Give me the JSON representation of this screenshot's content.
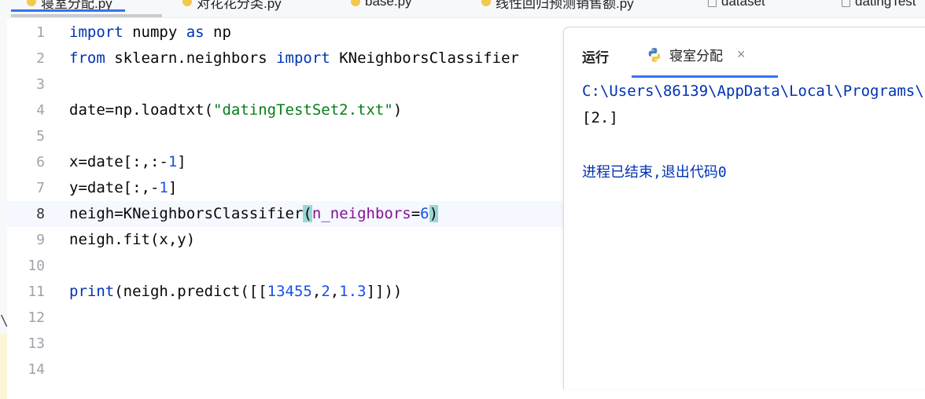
{
  "tabs": [
    {
      "label": "寝室分配.py",
      "icon": "python-file-icon"
    },
    {
      "label": "对花花分类.py",
      "icon": "python-file-icon"
    },
    {
      "label": "base.py",
      "icon": "python-file-icon"
    },
    {
      "label": "线性回归预测销售额.py",
      "icon": "python-file-icon"
    },
    {
      "label": "dataset",
      "icon": "text-file-icon"
    },
    {
      "label": "datingTest",
      "icon": "text-file-icon"
    }
  ],
  "line_numbers": [
    "1",
    "2",
    "3",
    "4",
    "5",
    "6",
    "7",
    "8",
    "9",
    "10",
    "11",
    "12",
    "13",
    "14"
  ],
  "code": {
    "l1": {
      "kw1": "import",
      "t1": " numpy ",
      "kw2": "as",
      "t2": " np"
    },
    "l2": {
      "kw1": "from",
      "t1": " sklearn.neighbors ",
      "kw2": "import",
      "t2": " KNeighborsClassifier"
    },
    "l4": {
      "t1": "date=np.loadtxt(",
      "s1": "\"datingTestSet2.txt\"",
      "t2": ")"
    },
    "l6": {
      "t1": "x=date[:,:-",
      "n1": "1",
      "t2": "]"
    },
    "l7": {
      "t1": "y=date[:,-",
      "n1": "1",
      "t2": "]"
    },
    "l8": {
      "t1": "neigh=KNeighborsClassifier",
      "p1": "(",
      "param": "n_neighbors",
      "t2": "=",
      "n1": "6",
      "p2": ")"
    },
    "l9": {
      "t1": "neigh.fit(x,y)"
    },
    "l11": {
      "kw1": "print",
      "t1": "(neigh.predict([[",
      "n1": "13455",
      "c1": ",",
      "n2": "2",
      "c2": ",",
      "n3": "1.3",
      "t2": "]]))"
    }
  },
  "run_panel": {
    "run_tab": "运行",
    "file_tab": "寝室分配",
    "close": "×",
    "output_path": "C:\\Users\\86139\\AppData\\Local\\Programs\\",
    "output_result": "[2.]",
    "exit_message": "进程已结束,退出代码0"
  }
}
